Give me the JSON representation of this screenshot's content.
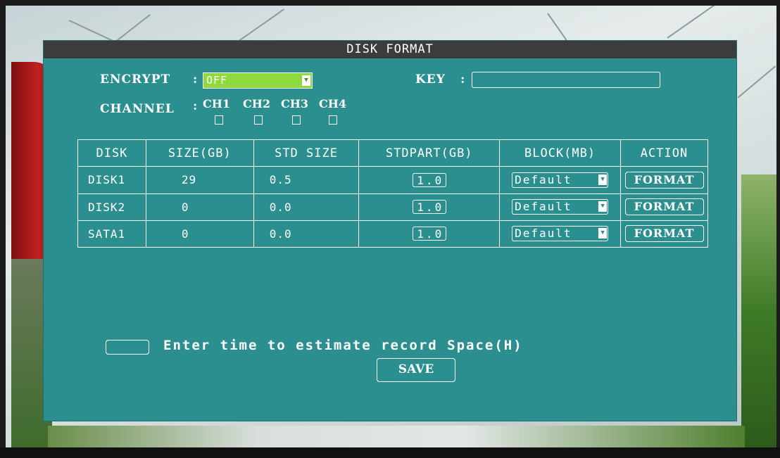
{
  "dialog": {
    "title": "DISK FORMAT",
    "encrypt": {
      "label": "ENCRYPT",
      "separator": ":",
      "value": "OFF"
    },
    "key": {
      "label": "KEY",
      "separator": ":",
      "value": ""
    },
    "channel": {
      "label": "CHANNEL",
      "separator": ":",
      "items": [
        {
          "label": "CH1",
          "checked": false
        },
        {
          "label": "CH2",
          "checked": false
        },
        {
          "label": "CH3",
          "checked": false
        },
        {
          "label": "CH4",
          "checked": false
        }
      ]
    },
    "table": {
      "headers": [
        "DISK",
        "SIZE(GB)",
        "STD SIZE",
        "STDPART(GB)",
        "BLOCK(MB)",
        "ACTION"
      ],
      "rows": [
        {
          "disk": "DISK1",
          "size": "29",
          "std_size": "0.5",
          "stdpart": "1.0",
          "block": "Default",
          "action": "FORMAT"
        },
        {
          "disk": "DISK2",
          "size": "0",
          "std_size": "0.0",
          "stdpart": "1.0",
          "block": "Default",
          "action": "FORMAT"
        },
        {
          "disk": "SATA1",
          "size": "0",
          "std_size": "0.0",
          "stdpart": "1.0",
          "block": "Default",
          "action": "FORMAT"
        }
      ]
    },
    "estimate": {
      "value": "",
      "label": "Enter time to estimate record Space(H)"
    },
    "save_label": "SAVE"
  },
  "colors": {
    "panel": "#2b8f8f",
    "titlebar": "#3c3c3c",
    "selected": "#8fd83e",
    "text": "#ffffff"
  },
  "icons": {
    "dropdown": "chevron-down-icon"
  }
}
